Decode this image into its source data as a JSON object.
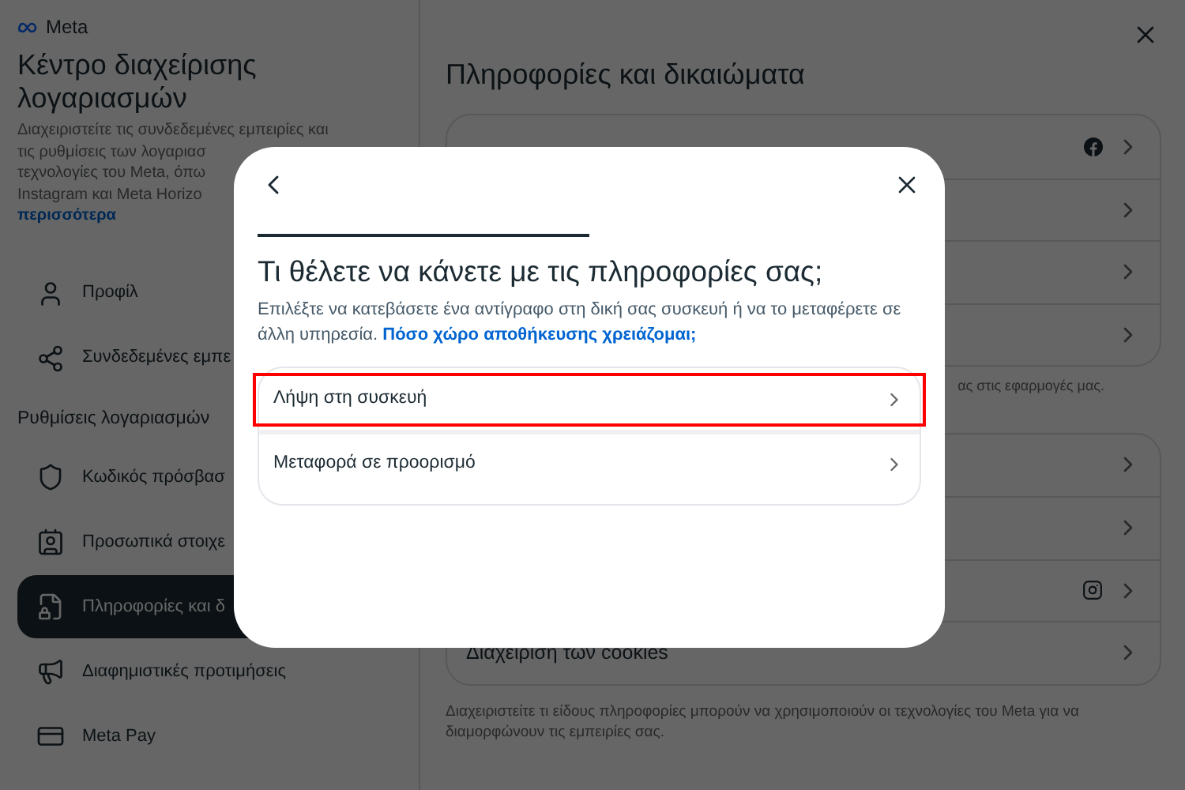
{
  "sidebar": {
    "brand": "Meta",
    "title": "Κέντρο διαχείρισης λογαριασμών",
    "description_lines": [
      "Διαχειριστείτε τις συνδεδεμένες εμπειρίες και",
      "τις ρυθμίσεις των λογαριασ",
      "τεχνολογίες του Meta, όπω",
      "Instagram και Meta Horizo"
    ],
    "more_link": "περισσότερα",
    "items": [
      {
        "kind": "profile",
        "label": "Προφίλ",
        "selected": false
      },
      {
        "kind": "connected",
        "label": "Συνδεδεμένες εμπε",
        "selected": false
      }
    ],
    "section_title": "Ρυθμίσεις λογαριασμών",
    "settings": [
      {
        "kind": "shield",
        "label": "Κωδικός πρόσβασ",
        "selected": false
      },
      {
        "kind": "id",
        "label": "Προσωπικά στοιχε",
        "selected": false
      },
      {
        "kind": "info",
        "label": "Πληροφορίες και δ",
        "selected": true
      },
      {
        "kind": "megaphone",
        "label": "Διαφημιστικές προτιμήσεις",
        "selected": false
      },
      {
        "kind": "card",
        "label": "Meta Pay",
        "selected": false
      }
    ]
  },
  "main": {
    "title": "Πληροφορίες και δικαιώματα",
    "group_1": [
      {
        "kind": "facebook"
      },
      {
        "kind": "plain"
      },
      {
        "kind": "plain"
      },
      {
        "kind": "plain"
      }
    ],
    "group_1_caption": "ας στις εφαρμογές μας.",
    "group_2": [
      {
        "kind": "plain"
      },
      {
        "kind": "plain"
      },
      {
        "kind": "instagram"
      },
      {
        "kind": "plain",
        "label": "Διαχείριση των cookies"
      }
    ],
    "group_2_caption": "Διαχειριστείτε τι είδους πληροφορίες μπορούν να χρησιμοποιούν οι τεχνολογίες του Meta για να διαμορφώνουν τις εμπειρίες σας."
  },
  "dialog": {
    "title": "Τι θέλετε να κάνετε με τις πληροφορίες σας;",
    "description": "Επιλέξτε να κατεβάσετε ένα αντίγραφο στη δική σας συσκευή ή να το μεταφέρετε σε άλλη υπηρεσία.",
    "link": "Πόσο χώρο αποθήκευσης χρειάζομαι;",
    "options": [
      {
        "label": "Λήψη στη συσκευή",
        "selected": true
      },
      {
        "label": "Μεταφορά σε προορισμό",
        "selected": false
      }
    ]
  }
}
